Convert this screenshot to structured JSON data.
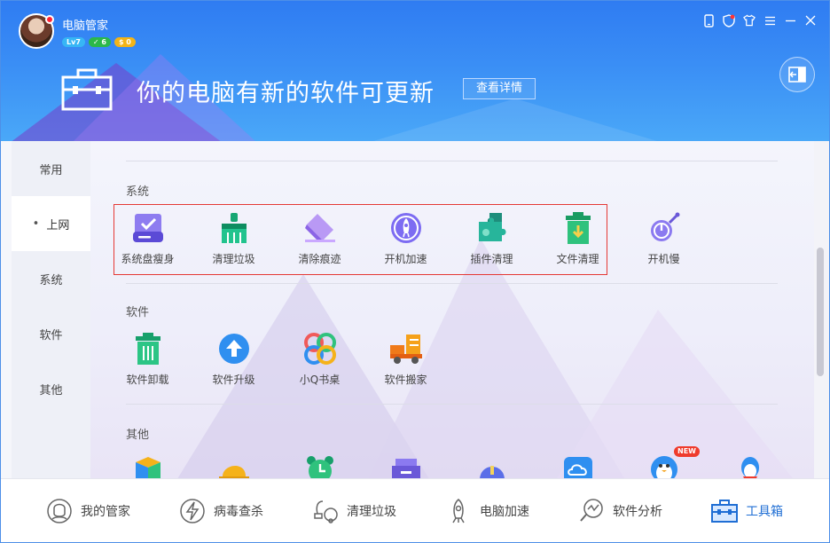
{
  "header": {
    "app_title": "电脑管家",
    "badges": {
      "level": "Lv7",
      "vip": "✓ 6",
      "coin": "$ 0"
    },
    "banner_text": "你的电脑有新的软件可更新",
    "banner_button": "查看详情"
  },
  "window_controls": [
    "phone-icon",
    "shield-icon",
    "shirt-icon",
    "menu-icon",
    "minimize-icon",
    "close-icon"
  ],
  "sidebar": {
    "items": [
      {
        "label": "常用",
        "active": false
      },
      {
        "label": "上网",
        "active": true
      },
      {
        "label": "系统",
        "active": false
      },
      {
        "label": "软件",
        "active": false
      },
      {
        "label": "其他",
        "active": false
      }
    ]
  },
  "sections": {
    "system": {
      "title": "系统",
      "tiles": [
        {
          "label": "系统盘瘦身",
          "icon": "disk-slim-icon"
        },
        {
          "label": "清理垃圾",
          "icon": "broom-icon"
        },
        {
          "label": "清除痕迹",
          "icon": "eraser-icon"
        },
        {
          "label": "开机加速",
          "icon": "rocket-icon"
        },
        {
          "label": "插件清理",
          "icon": "puzzle-icon"
        },
        {
          "label": "文件清理",
          "icon": "file-trash-icon"
        },
        {
          "label": "开机慢",
          "icon": "power-search-icon"
        }
      ]
    },
    "software": {
      "title": "软件",
      "tiles": [
        {
          "label": "软件卸载",
          "icon": "trash-icon"
        },
        {
          "label": "软件升级",
          "icon": "upgrade-icon"
        },
        {
          "label": "小Q书桌",
          "icon": "clover-icon"
        },
        {
          "label": "软件搬家",
          "icon": "truck-icon"
        }
      ]
    },
    "other": {
      "title": "其他",
      "tiles": [
        {
          "icon": "box-icon"
        },
        {
          "icon": "hat-icon"
        },
        {
          "icon": "alarm-clock-icon"
        },
        {
          "icon": "printer-icon"
        },
        {
          "icon": "dome-icon"
        },
        {
          "icon": "cloud-icon"
        },
        {
          "icon": "penguin-icon",
          "badge": "NEW"
        },
        {
          "icon": "qq-penguin-icon"
        }
      ]
    }
  },
  "bottom_nav": [
    {
      "label": "我的管家",
      "icon": "butler-icon",
      "active": false
    },
    {
      "label": "病毒查杀",
      "icon": "lightning-icon",
      "active": false
    },
    {
      "label": "清理垃圾",
      "icon": "vacuum-icon",
      "active": false
    },
    {
      "label": "电脑加速",
      "icon": "rocket-icon",
      "active": false
    },
    {
      "label": "软件分析",
      "icon": "analysis-icon",
      "active": false
    },
    {
      "label": "工具箱",
      "icon": "toolbox-icon",
      "active": true
    }
  ],
  "colors": {
    "accent": "#1f6ed4",
    "header_blue": "#3a8ef5",
    "highlight_red": "#e53935"
  }
}
